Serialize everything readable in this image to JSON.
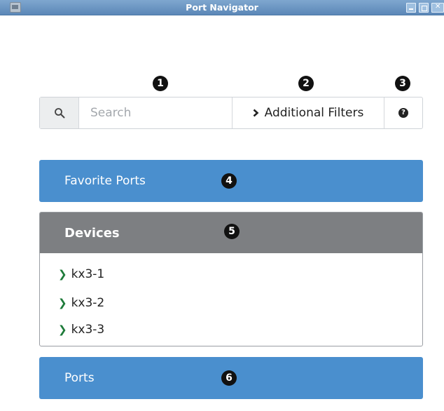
{
  "window": {
    "title": "Port Navigator"
  },
  "search": {
    "placeholder": "Search"
  },
  "filters": {
    "label": "Additional Filters"
  },
  "help": {
    "glyph": "?"
  },
  "callouts": [
    "1",
    "2",
    "3",
    "4",
    "5",
    "6"
  ],
  "panels": {
    "favorites": "Favorite Ports",
    "devices": "Devices",
    "ports": "Ports"
  },
  "devices": {
    "items": [
      "kx3-1",
      "kx3-2",
      "kx3-3"
    ]
  },
  "colors": {
    "panel_blue": "#4a8fce",
    "devices_header": "#7d7f82",
    "chevron_green": "#1e7b3a"
  },
  "icons": {
    "search": "magnifier-icon",
    "filters": "chevron-right-icon",
    "help": "question-circle-icon",
    "device": "chevron-right-icon"
  }
}
